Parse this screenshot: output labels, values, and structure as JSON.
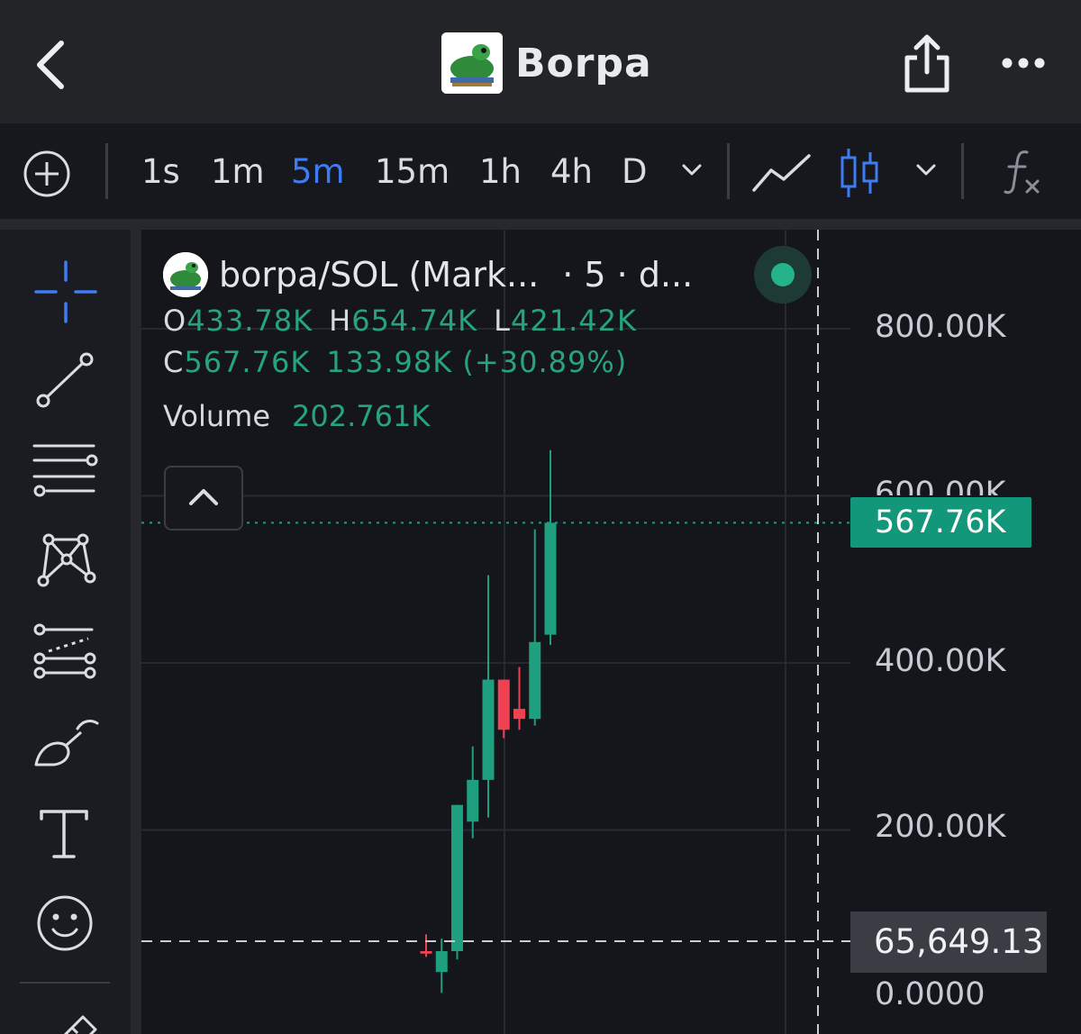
{
  "nav": {
    "title": "Borpa",
    "back_icon": "chevron-left-icon",
    "share_icon": "share-icon",
    "more_icon": "more-horizontal-icon"
  },
  "toolbar": {
    "timeframes": [
      "1s",
      "1m",
      "5m",
      "15m",
      "1h",
      "4h",
      "D"
    ],
    "active_timeframe": "5m",
    "icons": [
      "plus-circle-icon",
      "chevron-down-icon",
      "line-chart-icon",
      "candlestick-icon",
      "chevron-down-icon",
      "function-icon"
    ]
  },
  "sidebar": {
    "tools": [
      "crosshair-icon",
      "trend-line-icon",
      "horizontal-lines-icon",
      "pattern-icon",
      "projection-icon",
      "brush-icon",
      "text-icon",
      "emoji-icon",
      "ruler-icon"
    ]
  },
  "legend": {
    "symbol": "borpa/SOL (Mark...",
    "extra": "· 5 · d...",
    "open_label": "O",
    "open": "433.78K",
    "high_label": "H",
    "high": "654.74K",
    "low_label": "L",
    "low": "421.42K",
    "close_label": "C",
    "close": "567.76K",
    "change": "133.98K (+30.89%)",
    "volume_label": "Volume",
    "volume": "202.761K"
  },
  "price_axis": {
    "labels": [
      "800.00K",
      "600.00K",
      "400.00K",
      "200.00K",
      "0.0000"
    ],
    "last_price": "567.76K",
    "crosshair_price": "65,649.13"
  },
  "colors": {
    "up": "#1e9f7e",
    "down": "#f04152",
    "accent": "#3d7cf5",
    "last_price_bg": "#13977a"
  },
  "chart_data": {
    "type": "candlestick",
    "ylim": [
      0,
      800000
    ],
    "candles": [
      {
        "o": 55000,
        "h": 75000,
        "l": 48000,
        "c": 52000
      },
      {
        "o": 30000,
        "h": 70000,
        "l": 5000,
        "c": 55000
      },
      {
        "o": 55000,
        "h": 230000,
        "l": 45000,
        "c": 230000
      },
      {
        "o": 210000,
        "h": 300000,
        "l": 190000,
        "c": 260000
      },
      {
        "o": 260000,
        "h": 505000,
        "l": 215000,
        "c": 380000
      },
      {
        "o": 380000,
        "h": 380000,
        "l": 310000,
        "c": 320000
      },
      {
        "o": 345000,
        "h": 395000,
        "l": 320000,
        "c": 333000
      },
      {
        "o": 333000,
        "h": 560000,
        "l": 325000,
        "c": 425000
      },
      {
        "o": 433780,
        "h": 654740,
        "l": 421420,
        "c": 567760
      }
    ]
  }
}
